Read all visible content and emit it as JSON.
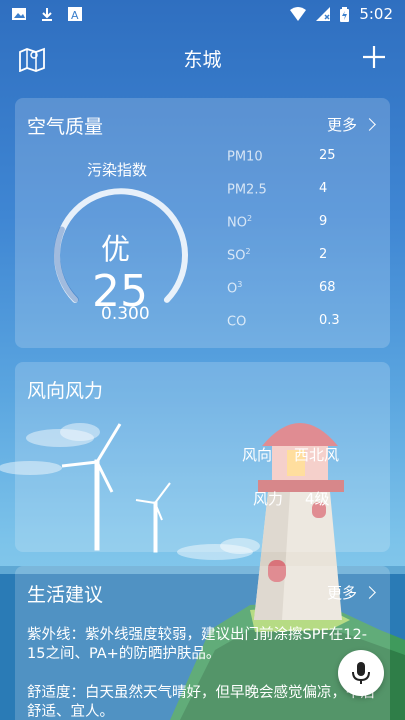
{
  "status_bar": {
    "time": "5:02"
  },
  "header": {
    "title": "东城"
  },
  "aqi_card": {
    "title": "空气质量",
    "more": "更多",
    "index_label": "污染指数",
    "level": "优",
    "value": "25",
    "sub_value": "0.300",
    "gauge_fraction": 0.25,
    "pollutants": [
      {
        "name": "PM10",
        "sub": "",
        "value": "25"
      },
      {
        "name": "PM2.5",
        "sub": "",
        "value": "4"
      },
      {
        "name": "NO",
        "sub": "2",
        "value": "9"
      },
      {
        "name": "SO",
        "sub": "2",
        "value": "2"
      },
      {
        "name": "O",
        "sub": "3",
        "value": "68"
      },
      {
        "name": "CO",
        "sub": "",
        "value": "0.3"
      }
    ]
  },
  "wind_card": {
    "title": "风向风力",
    "direction_label": "风向",
    "direction_value": "西北风",
    "force_label": "风力",
    "force_value": "4级"
  },
  "life_card": {
    "title": "生活建议",
    "more": "更多",
    "uv_text": "紫外线：紫外线强度较弱，建议出门前涂擦SPF在12-15之间、PA+的防晒护肤品。",
    "comfort_text": "舒适度：白天虽然天气晴好，但早晚会感觉偏凉，午后舒适、宜人。"
  },
  "colors": {
    "accent": "#ffffff",
    "background_top": "#2f6fc0",
    "background_bottom": "#9ad4ef"
  }
}
